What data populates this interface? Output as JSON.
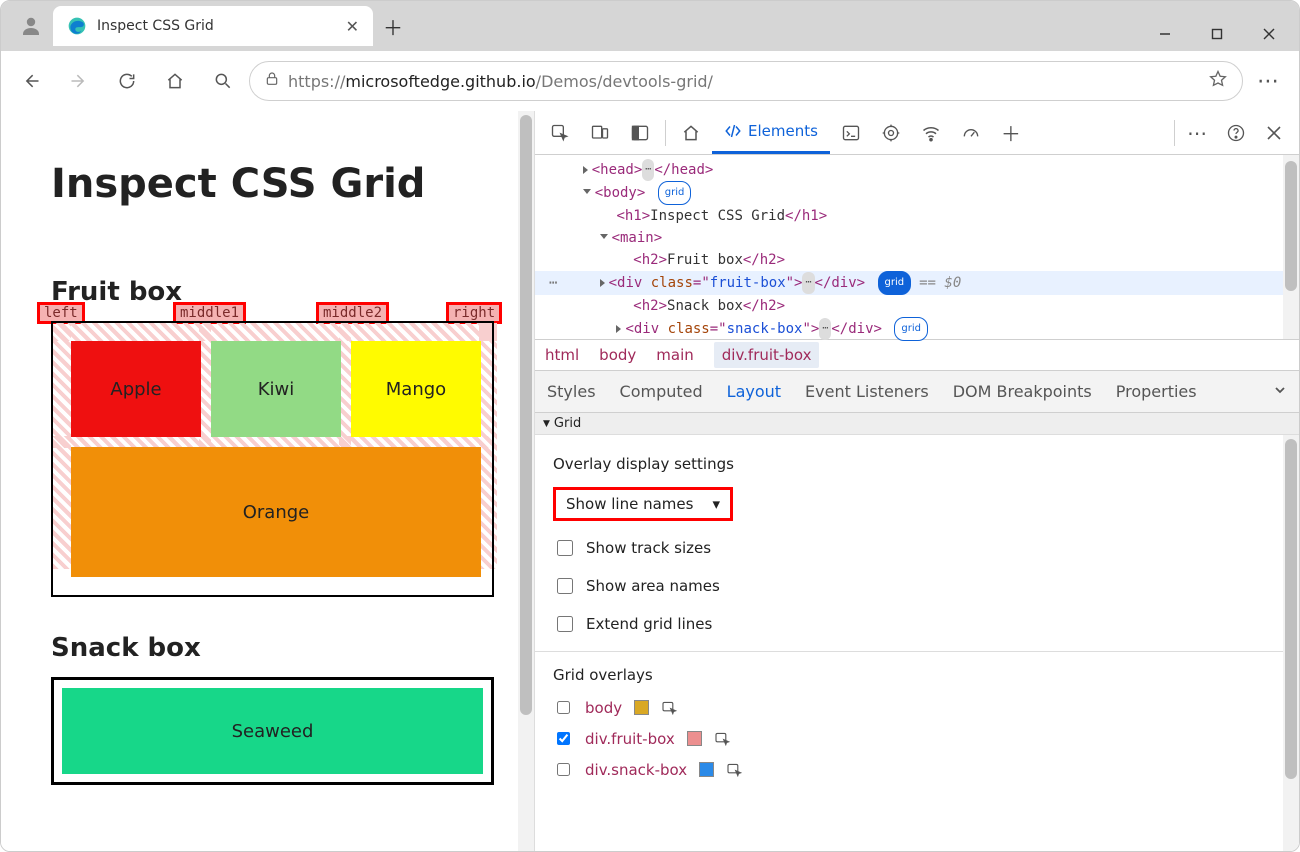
{
  "tab_title": "Inspect CSS Grid",
  "url_prefix": "https://",
  "url_host": "microsoftedge.github.io",
  "url_path": "/Demos/devtools-grid/",
  "page": {
    "h1": "Inspect CSS Grid",
    "h2_fruit": "Fruit box",
    "h2_snack": "Snack box",
    "line_labels": [
      "left",
      "middle1",
      "middle2",
      "right"
    ],
    "cells": {
      "apple": "Apple",
      "kiwi": "Kiwi",
      "mango": "Mango",
      "orange": "Orange",
      "seaweed": "Seaweed"
    }
  },
  "devtools": {
    "elements_tab": "Elements",
    "dom": {
      "head": "head",
      "body": "body",
      "grid": "grid",
      "h1_text": "Inspect CSS Grid",
      "main": "main",
      "h2_fruit": "Fruit box",
      "h2_snack": "Snack box",
      "div": "div",
      "class": "class",
      "fruit_val": "fruit-box",
      "snack_val": "snack-box",
      "eq0": "== $0"
    },
    "crumbs": [
      "html",
      "body",
      "main",
      "div.fruit-box"
    ],
    "subtabs": [
      "Styles",
      "Computed",
      "Layout",
      "Event Listeners",
      "DOM Breakpoints",
      "Properties"
    ],
    "grid_section": "Grid",
    "overlay_title": "Overlay display settings",
    "select_value": "Show line names",
    "checkboxes": [
      "Show track sizes",
      "Show area names",
      "Extend grid lines"
    ],
    "overlays_title": "Grid overlays",
    "overlays": [
      {
        "name": "body",
        "color": "#d9a824",
        "checked": false
      },
      {
        "name": "div.fruit-box",
        "color": "#ec8f8f",
        "checked": true
      },
      {
        "name": "div.snack-box",
        "color": "#2b8ae8",
        "checked": false
      }
    ]
  }
}
